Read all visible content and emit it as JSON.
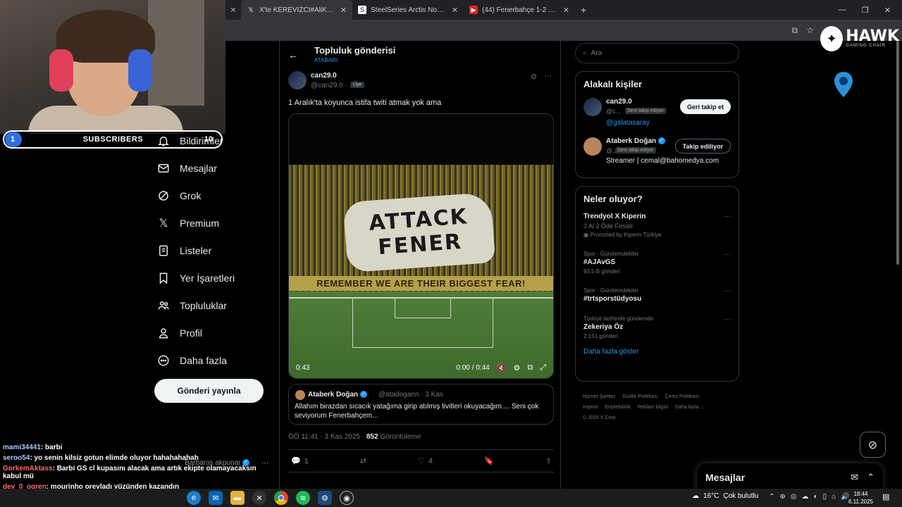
{
  "browser": {
    "tabs": [
      {
        "title": "X'te KEREVİZCİ#AliKoçYuvaya: \"...",
        "icon": "x-logo-icon",
        "active": true
      },
      {
        "title": "SteelSeries Arctis Nova Pro Wir...",
        "icon": "steelseries-icon",
        "active": false
      },
      {
        "title": "(44) Fenerbahçe 1-2 Galatasaray...",
        "icon": "youtube-icon",
        "active": false
      }
    ],
    "new_tab": "+"
  },
  "stream": {
    "subscribers_count": "1",
    "subscribers_label": "SUBSCRIBERS",
    "subscribers_goal": "10",
    "chat": [
      {
        "user": "mami34441",
        "message": ": barbi",
        "color": "#a9c8ff"
      },
      {
        "user": "seroo54",
        "message": ": yo senin kilsiz gotun elimde oluyor hahahahahah",
        "color": "#a9c8ff"
      },
      {
        "user": "GorkemAktass",
        "message": ": Barbi GS cl kupasını alacak ama artık ekipte olamayacaksın kabul mü",
        "color": "#ff6b6b"
      },
      {
        "user": "dey_0_ogren",
        "message": ": mourinho orevladı yüzünden kazandın",
        "color": "#ff6b6b"
      }
    ],
    "faint_user": "Barbaros akpunar"
  },
  "nav": {
    "items": [
      {
        "label": "Bildirimler",
        "icon": "bell-icon"
      },
      {
        "label": "Mesajlar",
        "icon": "mail-icon"
      },
      {
        "label": "Grok",
        "icon": "grok-icon"
      },
      {
        "label": "Premium",
        "icon": "x-premium-icon"
      },
      {
        "label": "Listeler",
        "icon": "list-icon"
      },
      {
        "label": "Yer İşaretleri",
        "icon": "bookmark-icon"
      },
      {
        "label": "Topluluklar",
        "icon": "communities-icon"
      },
      {
        "label": "Profil",
        "icon": "profile-icon"
      },
      {
        "label": "Daha fazla",
        "icon": "more-circle-icon"
      }
    ],
    "post_button": "Gönderi yayınla"
  },
  "post": {
    "header_title": "Topluluk gönderisi",
    "header_sub": "ATABARI",
    "author_name": "can29.0",
    "author_handle": "@can29.0 ·",
    "author_badge": "Üye",
    "text": "1 Aralık'ta koyunca istifa twiti atmak yok ama",
    "video": {
      "tifo_line1": "ATTACK",
      "tifo_line2": "FENER",
      "banner": "REMEMBER WE ARE THEIR BIGGEST FEAR!",
      "elapsed": "0:43",
      "time": "0:00 / 0:44"
    },
    "quote": {
      "name": "Ataberk Doğan",
      "handle": "@atadogann · 3 Kas",
      "text": "Allahım birazdan sıcacık yatağıma girip atılmış tivitleri okuyacağım.... Seni çok seviyorum Fenerbahçem..."
    },
    "meta_time": "ÖÖ 11:41 · 3 Kas 2025 ·",
    "views_count": "852",
    "views_label": "Görüntüleme",
    "actions": {
      "replies": "1",
      "likes": "4"
    }
  },
  "sidebar": {
    "search_placeholder": "Ara",
    "relevant_title": "Alakalı kişiler",
    "people": [
      {
        "name": "can29.0",
        "handle": "@c...",
        "tag": "Seni takip ediyor",
        "extra": "@galatasaray",
        "button": "Geri takip et"
      },
      {
        "name": "Ataberk Doğan",
        "handle": "@...",
        "tag": "Seni takip ediyor",
        "extra": "Streamer | cemal@bahomedya.com",
        "button": "Takip ediliyor"
      }
    ],
    "trends_title": "Neler oluyor?",
    "trends": [
      {
        "category": "",
        "name": "Trendyol X Kiperin",
        "sub1": "3 Al 2 Öde Fırsatı",
        "sub2": "Promoted by Kiperin Türkiye"
      },
      {
        "category": "Spor · Gündemdekiler",
        "name": "#AJAvGS",
        "sub1": "93,5 B gönderi",
        "sub2": ""
      },
      {
        "category": "Spor · Gündemdekiler",
        "name": "#trtsporstüdyosu",
        "sub1": "",
        "sub2": ""
      },
      {
        "category": "Türkiye tarihinde gündemde",
        "name": "Zekeriya Öz",
        "sub1": "2.151 gönderi",
        "sub2": ""
      }
    ],
    "show_more": "Daha fazla göster",
    "footer": [
      "Hizmet Şartları",
      "Gizlilik Politikası",
      "Çerez Politikası",
      "Imprint",
      "Erişilebilirlik",
      "Reklam bilgisi",
      "Daha fazla ...",
      "© 2025 X Corp."
    ]
  },
  "overlay": {
    "hawk_title": "HAWK",
    "hawk_sub": "GAMING CHAIR"
  },
  "messages_dock": {
    "title": "Mesajlar"
  },
  "taskbar": {
    "temperature": "16°C",
    "weather": "Çok bulutlu",
    "time": "18:44",
    "date": "6.11.2025"
  },
  "colors": {
    "accent": "#1d9bf0",
    "border": "#2f3336",
    "muted": "#71767b"
  }
}
